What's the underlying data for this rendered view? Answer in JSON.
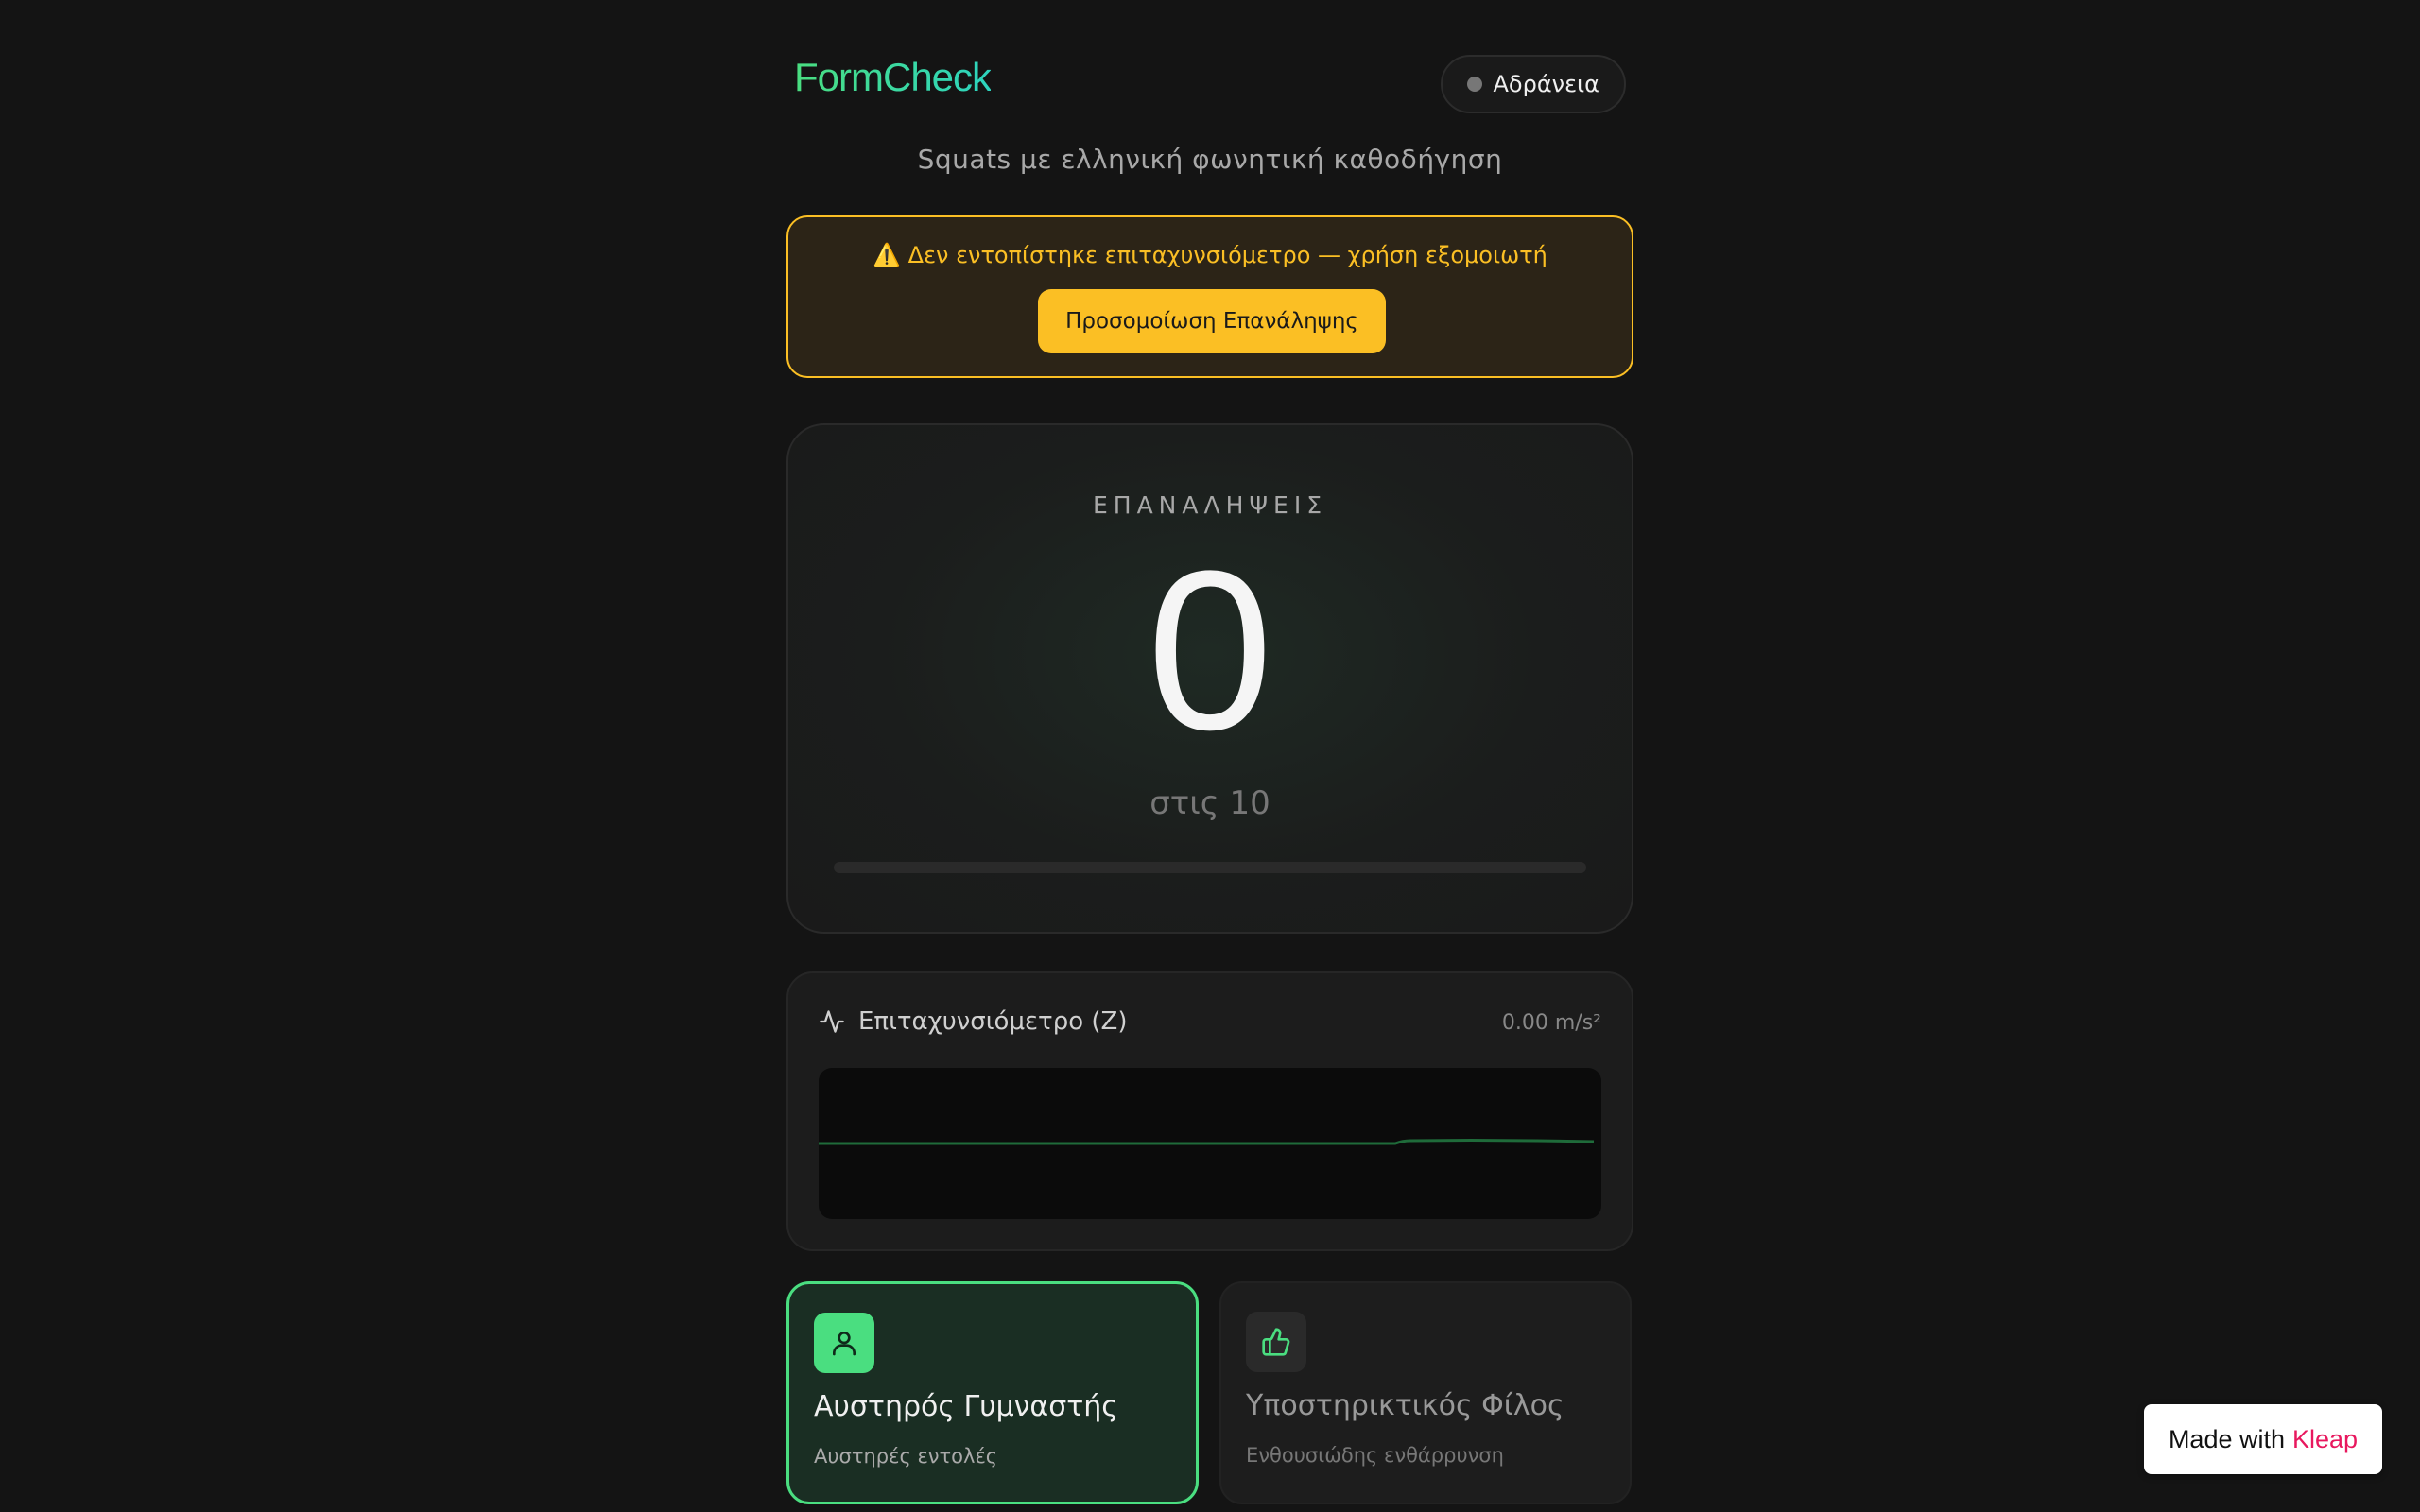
{
  "app": {
    "logo": "FormCheck",
    "status": "Αδράνεια",
    "subtitle": "Squats με ελληνική φωνητική καθοδήγηση"
  },
  "warning": {
    "text": "⚠️ Δεν εντοπίστηκε επιταχυνσιόμετρο — χρήση εξομοιωτή",
    "button_label": "Προσομοίωση Επανάληψης"
  },
  "reps": {
    "label": "ΕΠΑΝΑΛΗΨΕΙΣ",
    "count": "0",
    "target_text": "στις 10",
    "progress": 0
  },
  "accelerometer": {
    "title": "Επιταχυνσιόμετρο (Z)",
    "value": "0.00 m/s²"
  },
  "modes": [
    {
      "title": "Αυστηρός Γυμναστής",
      "description": "Αυστηρές εντολές",
      "selected": true,
      "icon": "user-icon"
    },
    {
      "title": "Υποστηρικτικός Φίλος",
      "description": "Ενθουσιώδης ενθάρρυνση",
      "selected": false,
      "icon": "thumbs-up-icon"
    }
  ],
  "badge": {
    "prefix": "Made with",
    "brand": "Kleap"
  },
  "colors": {
    "accent": "#4ade80",
    "warning": "#fbbf24",
    "background": "#141414",
    "brand": "#e8185e"
  }
}
